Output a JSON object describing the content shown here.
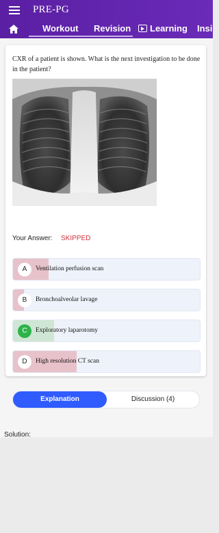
{
  "app": {
    "title": "PRE-PG"
  },
  "tabs": {
    "home_icon": "home-icon",
    "workout": "Workout",
    "revision": "Revision",
    "learning": "Learning",
    "insights": "Insights"
  },
  "question": {
    "text": "CXR of a patient is shown. What is the next investigation to be done in the patient?",
    "image": "chest-xray"
  },
  "answer": {
    "label": "Your Answer:",
    "status": "SKIPPED",
    "status_color": "#d0303c"
  },
  "options": [
    {
      "letter": "A",
      "text": "Ventilation perfusion scan",
      "fill_fraction": 0.19,
      "fill_color": "#e8c2cb",
      "correct": false
    },
    {
      "letter": "B",
      "text": "Bronchoalveolar lavage",
      "fill_fraction": 0.06,
      "fill_color": "#e8c2cb",
      "correct": false
    },
    {
      "letter": "C",
      "text": "Exploratory laparotomy",
      "fill_fraction": 0.22,
      "fill_color": "#cfe6d4",
      "correct": true
    },
    {
      "letter": "D",
      "text": "High resolution CT scan",
      "fill_fraction": 0.34,
      "fill_color": "#e8c2cb",
      "correct": false
    }
  ],
  "toggle": {
    "explanation": "Explanation",
    "discussion": "Discussion (4)",
    "accent": "#2f5bff"
  },
  "solution": {
    "label": "Solution:"
  }
}
